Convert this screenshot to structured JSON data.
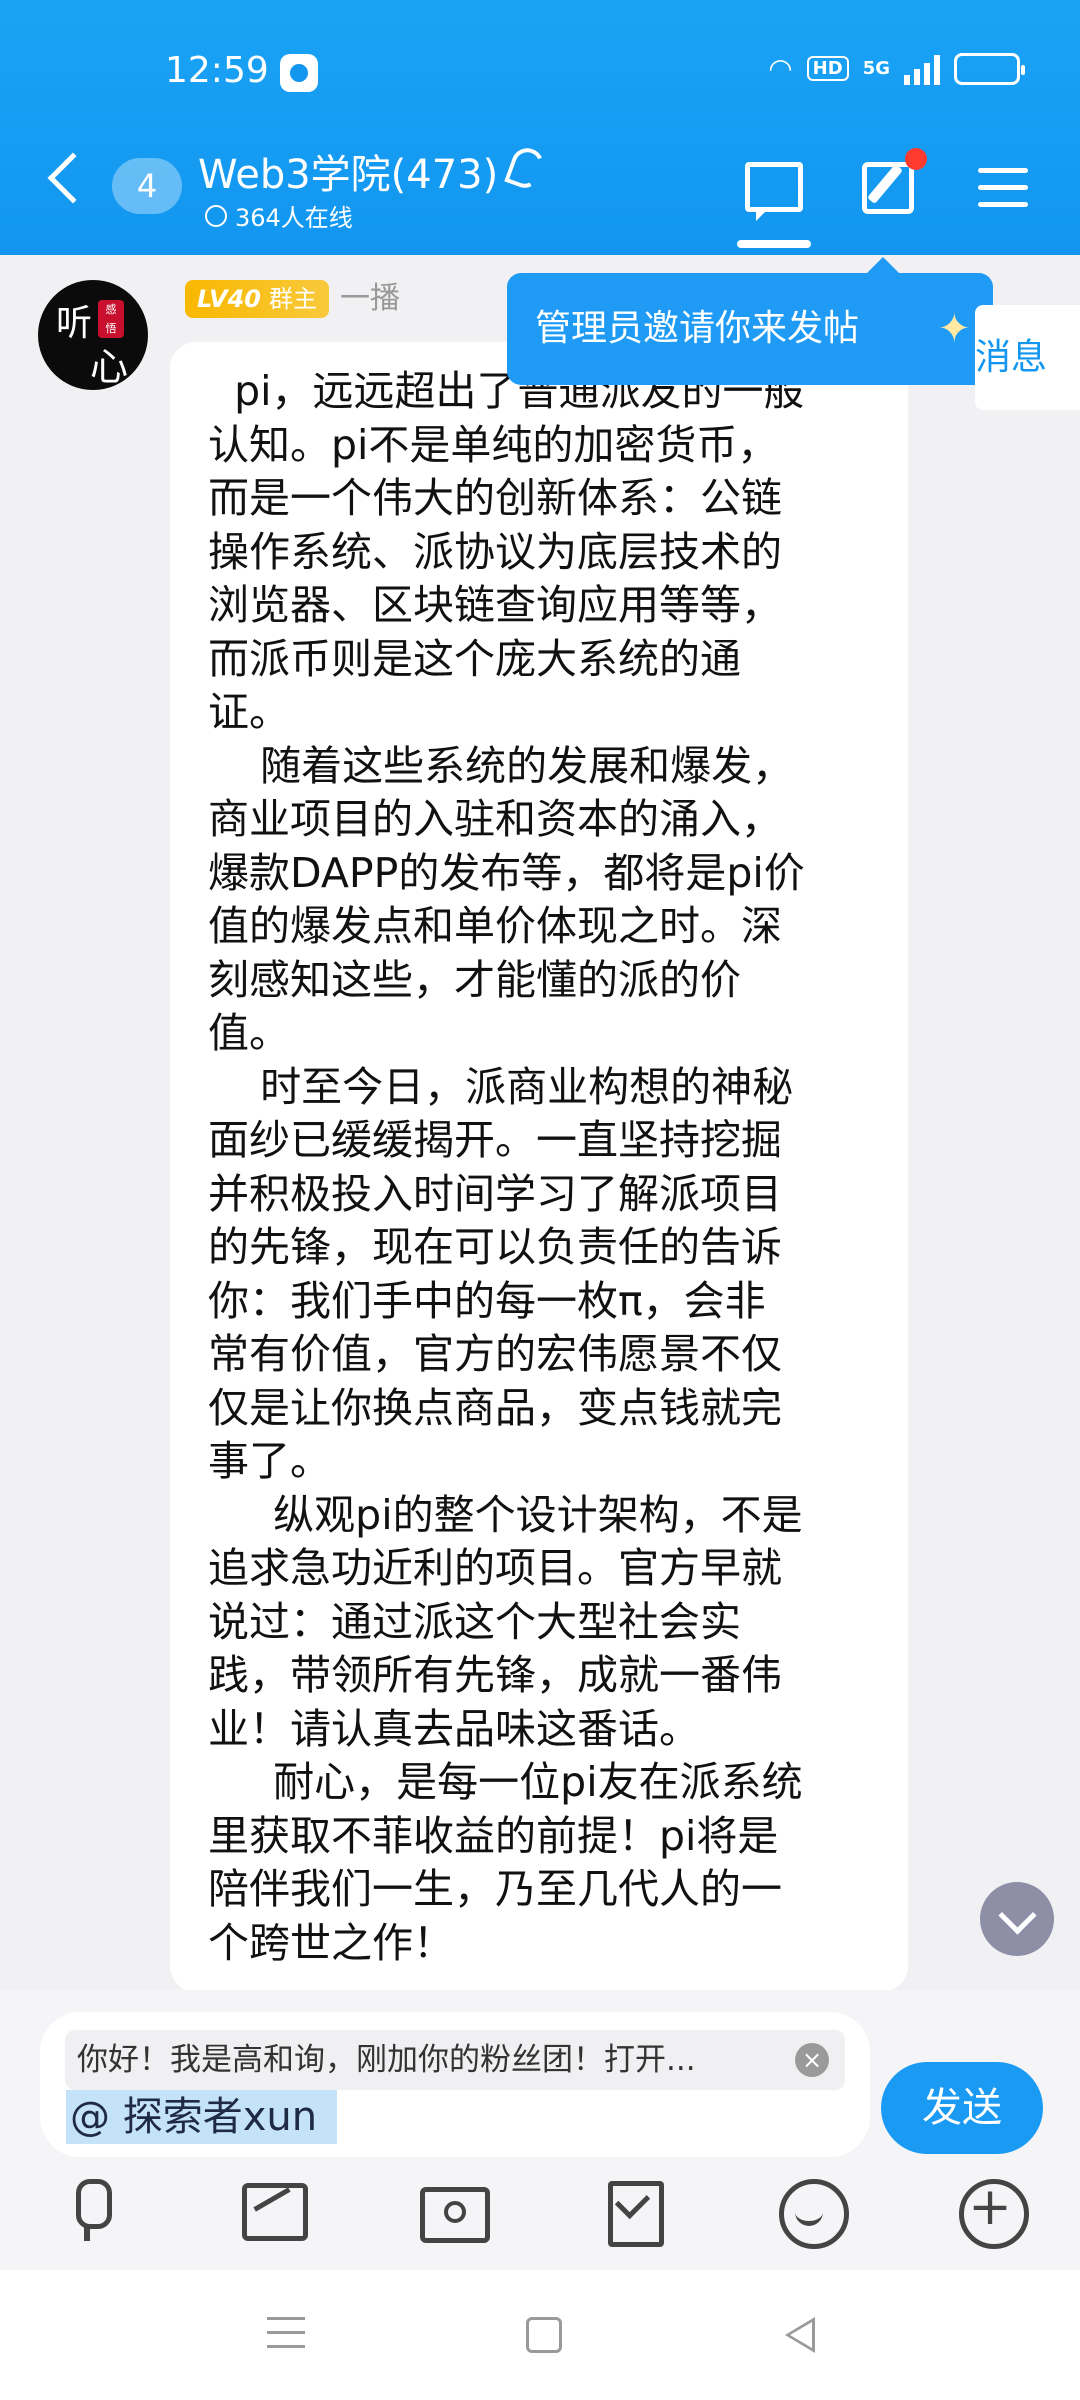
{
  "status_bar": {
    "time": "12:59",
    "hd": "HD",
    "network": "5G",
    "battery_level": 1.0
  },
  "header": {
    "back_count": "4",
    "title": "Web3学院(473)",
    "online": "364人在线",
    "accent_color": "#1296F0"
  },
  "message": {
    "level": "LV40",
    "role": "群主",
    "sender": "一播",
    "paragraphs": [
      "  pi，远远超出了普通派友的一般",
      "认知。pi不是单纯的加密货币，",
      "而是一个伟大的创新体系：公链",
      "操作系统、派协议为底层技术的",
      "浏览器、区块链查询应用等等，",
      "而派币则是这个庞大系统的通",
      "证。",
      "    随着这些系统的发展和爆发，",
      "商业项目的入驻和资本的涌入，",
      "爆款DAPP的发布等，都将是pi价",
      "值的爆发点和单价体现之时。深",
      "刻感知这些，才能懂的派的价",
      "值。",
      "    时至今日，派商业构想的神秘",
      "面纱已缓缓揭开。一直坚持挖掘",
      "并积极投入时间学习了解派项目",
      "的先锋，现在可以负责任的告诉",
      "你：我们手中的每一枚π，会非",
      "常有价值，官方的宏伟愿景不仅",
      "仅是让你换点商品，变点钱就完",
      "事了。",
      "     纵观pi的整个设计架构，不是",
      "追求急功近利的项目。官方早就",
      "说过：通过派这个大型社会实",
      "践，带领所有先锋，成就一番伟",
      "业！请认真去品味这番话。",
      "     耐心，是每一位pi友在派系统",
      "里获取不菲收益的前提！pi将是",
      "陪伴我们一生，乃至几代人的一",
      "个跨世之作！"
    ]
  },
  "toast": {
    "text": "管理员邀请你来发帖",
    "sparkle": "✦"
  },
  "side_link": {
    "text": "消息"
  },
  "input": {
    "quote": "你好！我是高和询，刚加你的粉丝团！打开...",
    "close": "×",
    "mention": "@ 探索者xun",
    "send_label": "发送"
  },
  "toolbar": {
    "icons": [
      "mic-icon",
      "image-icon",
      "camera-icon",
      "gift-icon",
      "emoji-icon",
      "plus-icon"
    ]
  },
  "nav": {
    "icons": [
      "menu-icon",
      "home-icon",
      "back-icon"
    ]
  }
}
